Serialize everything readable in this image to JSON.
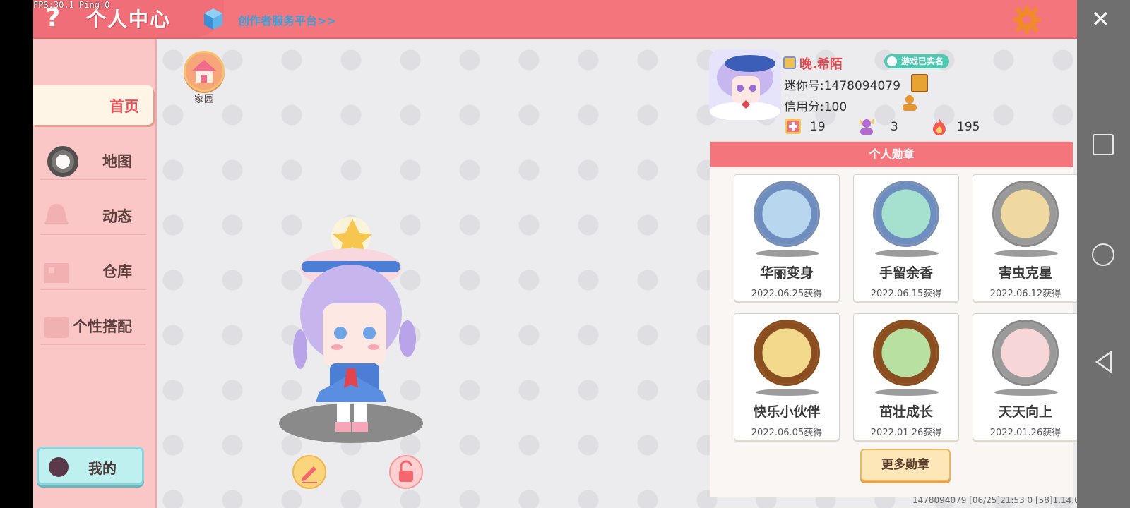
{
  "debug": {
    "fps_text": "FPS:30.1  Ping:0"
  },
  "header": {
    "help_label": "?",
    "title": "个人中心",
    "creator_link": "创作者服务平台>>",
    "settings_icon": "gear-icon",
    "close_label": "✕"
  },
  "sidebar": {
    "items": [
      {
        "label": "首页",
        "icon": "home-icon",
        "active": true
      },
      {
        "label": "地图",
        "icon": "map-icon",
        "active": false
      },
      {
        "label": "动态",
        "icon": "bell-icon",
        "active": false
      },
      {
        "label": "仓库",
        "icon": "warehouse-icon",
        "active": false
      },
      {
        "label": "个性搭配",
        "icon": "outfit-icon",
        "active": false
      }
    ],
    "my_button_label": "我的"
  },
  "home": {
    "label": "家园"
  },
  "profile": {
    "name": "晚.希陌",
    "verified_label": "游戏已实名",
    "mini_id": "迷你号:1478094079",
    "credit": "信用分:100",
    "stats": {
      "a": "19",
      "b": "3",
      "c": "195"
    }
  },
  "badges": {
    "title": "个人勋章",
    "items": [
      {
        "name": "华丽变身",
        "date": "2022.06.25获得",
        "tier": "silver"
      },
      {
        "name": "手留余香",
        "date": "2022.06.15获得",
        "tier": "silver"
      },
      {
        "name": "害虫克星",
        "date": "2022.06.12获得",
        "tier": "iron"
      },
      {
        "name": "快乐小伙伴",
        "date": "2022.06.05获得",
        "tier": "bronze"
      },
      {
        "name": "茁壮成长",
        "date": "2022.01.26获得",
        "tier": "bronze"
      },
      {
        "name": "天天向上",
        "date": "2022.01.26获得",
        "tier": "iron"
      }
    ],
    "more_label": "更多勋章"
  },
  "footer": {
    "info": "1478094079    [06/25]21:53 0 [58]1.14.0"
  },
  "colors": {
    "header": "#f4757c",
    "sidebar": "#fbc6c6",
    "accent": "#e85157"
  }
}
